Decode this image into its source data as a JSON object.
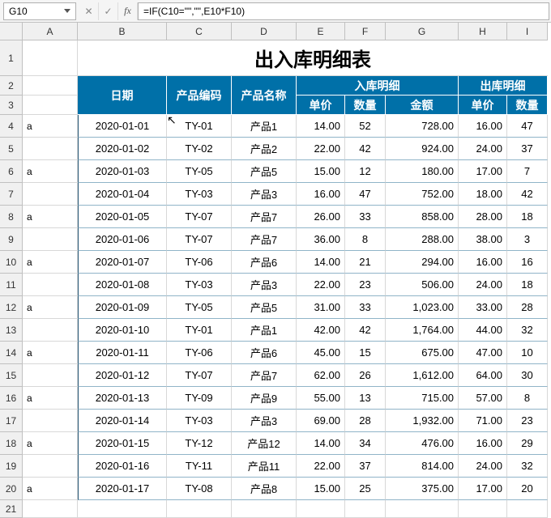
{
  "namebox": "G10",
  "formula": "=IF(C10=\"\",\"\",E10*F10)",
  "title": "出入库明细表",
  "columns": [
    "A",
    "B",
    "C",
    "D",
    "E",
    "F",
    "G",
    "H",
    "I"
  ],
  "headers": {
    "date": "日期",
    "code": "产品编码",
    "name": "产品名称",
    "in_group": "入库明细",
    "out_group": "出库明细",
    "price": "单价",
    "qty": "数量",
    "amount": "金额"
  },
  "chart_data": {
    "type": "table",
    "columns": [
      "a",
      "date",
      "code",
      "name",
      "in_price",
      "in_qty",
      "in_amount",
      "out_price",
      "out_qty"
    ],
    "rows": [
      {
        "a": "a",
        "date": "2020-01-01",
        "code": "TY-01",
        "name": "产品1",
        "in_price": "14.00",
        "in_qty": "52",
        "in_amount": "728.00",
        "out_price": "16.00",
        "out_qty": "47"
      },
      {
        "a": "",
        "date": "2020-01-02",
        "code": "TY-02",
        "name": "产品2",
        "in_price": "22.00",
        "in_qty": "42",
        "in_amount": "924.00",
        "out_price": "24.00",
        "out_qty": "37"
      },
      {
        "a": "a",
        "date": "2020-01-03",
        "code": "TY-05",
        "name": "产品5",
        "in_price": "15.00",
        "in_qty": "12",
        "in_amount": "180.00",
        "out_price": "17.00",
        "out_qty": "7"
      },
      {
        "a": "",
        "date": "2020-01-04",
        "code": "TY-03",
        "name": "产品3",
        "in_price": "16.00",
        "in_qty": "47",
        "in_amount": "752.00",
        "out_price": "18.00",
        "out_qty": "42"
      },
      {
        "a": "a",
        "date": "2020-01-05",
        "code": "TY-07",
        "name": "产品7",
        "in_price": "26.00",
        "in_qty": "33",
        "in_amount": "858.00",
        "out_price": "28.00",
        "out_qty": "18"
      },
      {
        "a": "",
        "date": "2020-01-06",
        "code": "TY-07",
        "name": "产品7",
        "in_price": "36.00",
        "in_qty": "8",
        "in_amount": "288.00",
        "out_price": "38.00",
        "out_qty": "3"
      },
      {
        "a": "a",
        "date": "2020-01-07",
        "code": "TY-06",
        "name": "产品6",
        "in_price": "14.00",
        "in_qty": "21",
        "in_amount": "294.00",
        "out_price": "16.00",
        "out_qty": "16"
      },
      {
        "a": "",
        "date": "2020-01-08",
        "code": "TY-03",
        "name": "产品3",
        "in_price": "22.00",
        "in_qty": "23",
        "in_amount": "506.00",
        "out_price": "24.00",
        "out_qty": "18"
      },
      {
        "a": "a",
        "date": "2020-01-09",
        "code": "TY-05",
        "name": "产品5",
        "in_price": "31.00",
        "in_qty": "33",
        "in_amount": "1,023.00",
        "out_price": "33.00",
        "out_qty": "28"
      },
      {
        "a": "",
        "date": "2020-01-10",
        "code": "TY-01",
        "name": "产品1",
        "in_price": "42.00",
        "in_qty": "42",
        "in_amount": "1,764.00",
        "out_price": "44.00",
        "out_qty": "32"
      },
      {
        "a": "a",
        "date": "2020-01-11",
        "code": "TY-06",
        "name": "产品6",
        "in_price": "45.00",
        "in_qty": "15",
        "in_amount": "675.00",
        "out_price": "47.00",
        "out_qty": "10"
      },
      {
        "a": "",
        "date": "2020-01-12",
        "code": "TY-07",
        "name": "产品7",
        "in_price": "62.00",
        "in_qty": "26",
        "in_amount": "1,612.00",
        "out_price": "64.00",
        "out_qty": "30"
      },
      {
        "a": "a",
        "date": "2020-01-13",
        "code": "TY-09",
        "name": "产品9",
        "in_price": "55.00",
        "in_qty": "13",
        "in_amount": "715.00",
        "out_price": "57.00",
        "out_qty": "8"
      },
      {
        "a": "",
        "date": "2020-01-14",
        "code": "TY-03",
        "name": "产品3",
        "in_price": "69.00",
        "in_qty": "28",
        "in_amount": "1,932.00",
        "out_price": "71.00",
        "out_qty": "23"
      },
      {
        "a": "a",
        "date": "2020-01-15",
        "code": "TY-12",
        "name": "产品12",
        "in_price": "14.00",
        "in_qty": "34",
        "in_amount": "476.00",
        "out_price": "16.00",
        "out_qty": "29"
      },
      {
        "a": "",
        "date": "2020-01-16",
        "code": "TY-11",
        "name": "产品11",
        "in_price": "22.00",
        "in_qty": "37",
        "in_amount": "814.00",
        "out_price": "24.00",
        "out_qty": "32"
      },
      {
        "a": "a",
        "date": "2020-01-17",
        "code": "TY-08",
        "name": "产品8",
        "in_price": "15.00",
        "in_qty": "25",
        "in_amount": "375.00",
        "out_price": "17.00",
        "out_qty": "20"
      }
    ]
  }
}
